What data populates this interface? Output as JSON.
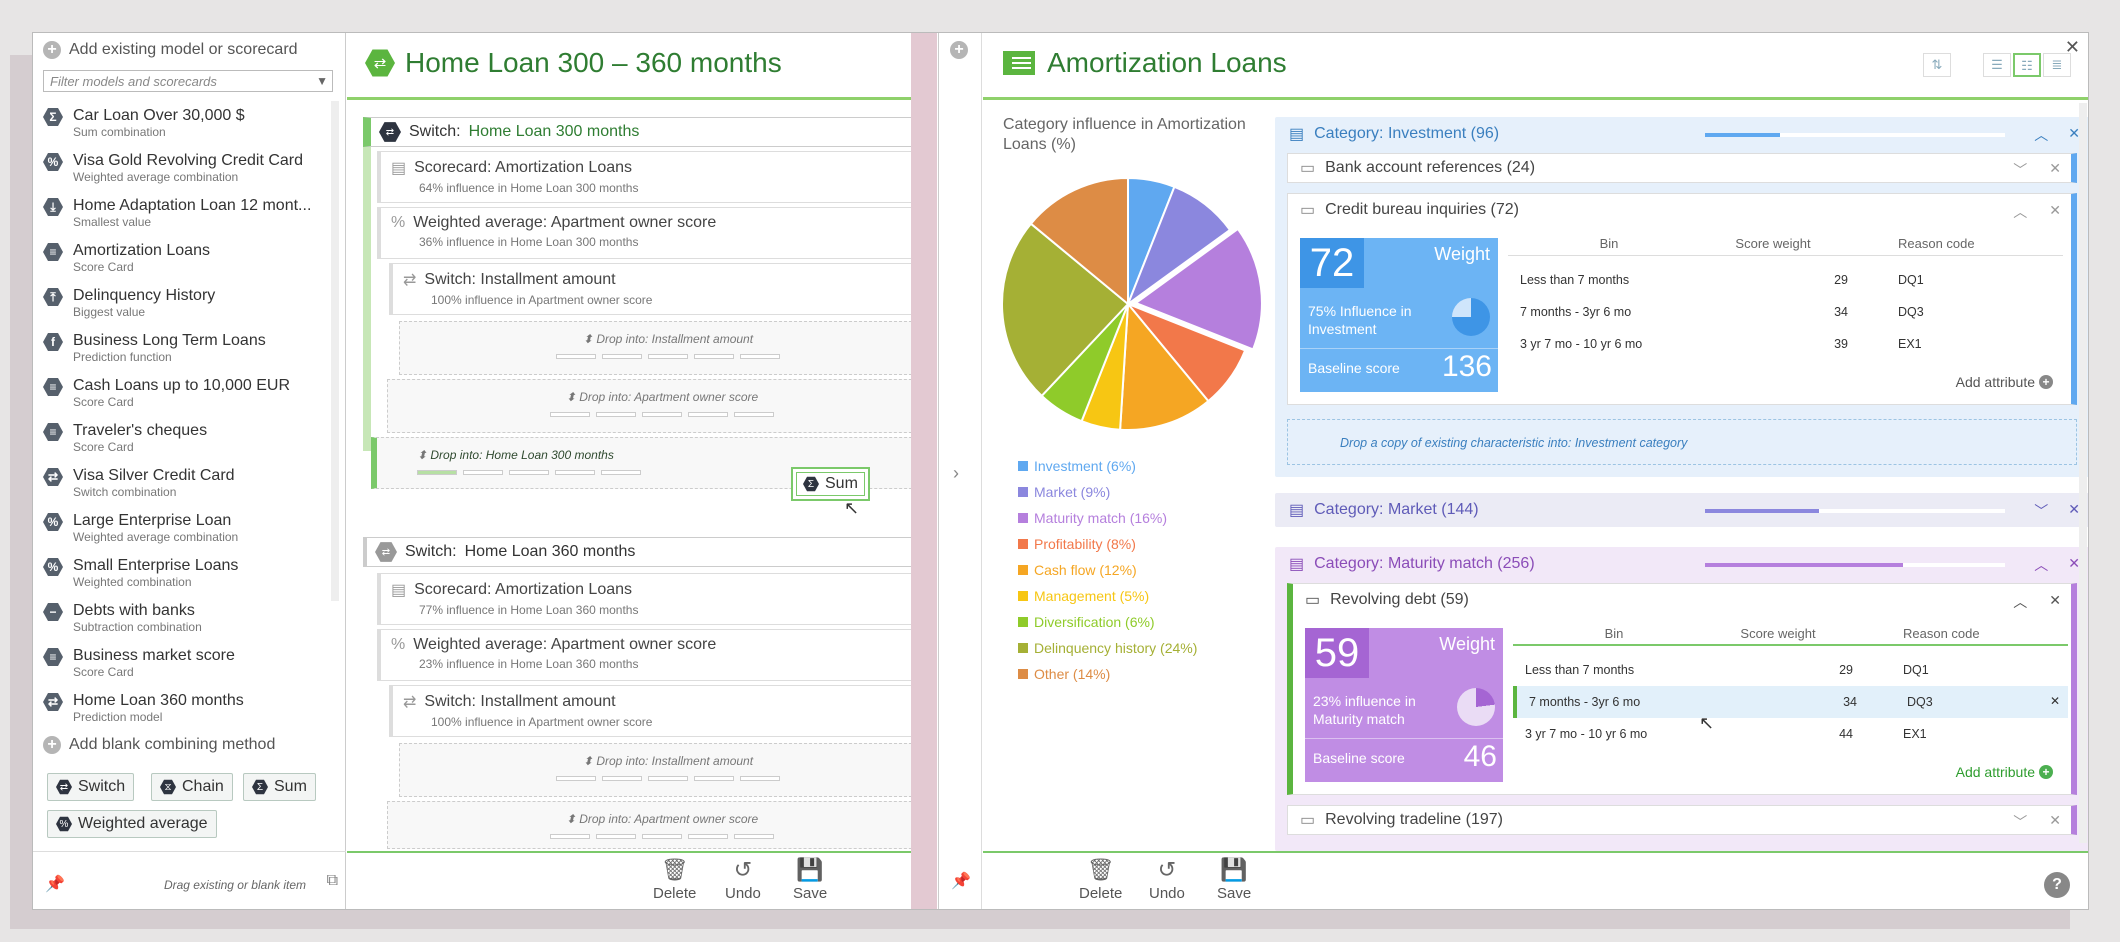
{
  "library": {
    "add_existing": "Add existing model or scorecard",
    "filter_placeholder": "Filter models and scorecards",
    "items": [
      {
        "name": "Car Loan Over 30,000 $",
        "sub": "Sum combination",
        "icon": "Σ"
      },
      {
        "name": "Visa Gold Revolving Credit Card",
        "sub": "Weighted average combination",
        "icon": "%"
      },
      {
        "name": "Home Adaptation Loan 12 mont...",
        "sub": "Smallest value",
        "icon": "⤓"
      },
      {
        "name": "Amortization Loans",
        "sub": "Score Card",
        "icon": "≡"
      },
      {
        "name": "Delinquency History",
        "sub": "Biggest value",
        "icon": "⤒"
      },
      {
        "name": "Business Long Term Loans",
        "sub": "Prediction function",
        "icon": "f"
      },
      {
        "name": "Cash Loans up to 10,000 EUR",
        "sub": "Score Card",
        "icon": "≡"
      },
      {
        "name": "Traveler's cheques",
        "sub": "Score Card",
        "icon": "≡"
      },
      {
        "name": "Visa Silver Credit Card",
        "sub": "Switch combination",
        "icon": "⇄"
      },
      {
        "name": "Large Enterprise Loan",
        "sub": "Weighted average combination",
        "icon": "%"
      },
      {
        "name": "Small Enterprise Loans",
        "sub": "Weighted combination",
        "icon": "%"
      },
      {
        "name": "Debts with banks",
        "sub": "Subtraction combination",
        "icon": "−"
      },
      {
        "name": "Business market score",
        "sub": "Score Card",
        "icon": "≡"
      },
      {
        "name": "Home Loan 360 months",
        "sub": "Prediction model",
        "icon": "⇄"
      }
    ],
    "add_blank": "Add blank combining method",
    "chips": {
      "switch": "Switch",
      "chain": "Chain",
      "sum": "Sum",
      "weighted": "Weighted average"
    },
    "footer_hint": "Drag existing or blank item"
  },
  "editor": {
    "title": "Home Loan 300 – 360 months",
    "switch1": {
      "prefix": "Switch:",
      "name": "Home Loan 300 months"
    },
    "s1_scorecard": {
      "title": "Scorecard:  Amortization Loans",
      "sub": "64% influence in Home Loan 300 months"
    },
    "s1_weighted": {
      "title": "Weighted average:  Apartment owner score",
      "sub": "36% influence in Home Loan 300 months"
    },
    "s1_switch": {
      "title": "Switch:  Installment amount",
      "sub": "100% influence in Apartment owner score"
    },
    "s1_drop1": "Drop into: Installment amount",
    "s1_drop2": "Drop into: Apartment owner score",
    "s1_drop3": "Drop into: Home Loan 300 months",
    "drag_ghost": "Sum",
    "switch2": {
      "prefix": "Switch:",
      "name": "Home Loan 360 months"
    },
    "s2_scorecard": {
      "title": "Scorecard:  Amortization Loans",
      "sub": "77% influence in Home Loan 360 months"
    },
    "s2_weighted": {
      "title": "Weighted average:  Apartment owner score",
      "sub": "23% influence in Home Loan 360 months"
    },
    "s2_switch": {
      "title": "Switch:  Installment amount",
      "sub": "100% influence in Apartment owner score"
    },
    "s2_drop1": "Drop into: Installment amount",
    "s2_drop2": "Drop into: Apartment owner score"
  },
  "footer": {
    "delete": "Delete",
    "undo": "Undo",
    "save": "Save"
  },
  "scorecard": {
    "title": "Amortization Loans",
    "pie_title": "Category influence in Amortization Loans (%)",
    "legend": [
      {
        "label": "Investment (6%)",
        "color": "#5fa8f0"
      },
      {
        "label": "Market (9%)",
        "color": "#8b87de"
      },
      {
        "label": "Maturity match (16%)",
        "color": "#b57fdd"
      },
      {
        "label": "Profitability (8%)",
        "color": "#f2784a"
      },
      {
        "label": "Cash flow (12%)",
        "color": "#f5a623"
      },
      {
        "label": "Management (5%)",
        "color": "#f7c613"
      },
      {
        "label": "Diversification (6%)",
        "color": "#8fcb2a"
      },
      {
        "label": "Delinquency history (24%)",
        "color": "#a5b035"
      },
      {
        "label": "Other (14%)",
        "color": "#dd8c45"
      }
    ],
    "cat_investment": "Category: Investment (96)",
    "bank_refs": "Bank account references (24)",
    "credit_bureau": "Credit bureau inquiries (72)",
    "cb_weight": "72",
    "cb_weight_label": "Weight",
    "cb_influence": "75% Influence in Investment",
    "cb_baseline_label": "Baseline score",
    "cb_baseline": "136",
    "table_headers": {
      "bin": "Bin",
      "weight": "Score weight",
      "reason": "Reason code"
    },
    "cb_rows": [
      {
        "bin": "Less than 7 months",
        "w": "29",
        "r": "DQ1"
      },
      {
        "bin": "7 months - 3yr 6 mo",
        "w": "34",
        "r": "DQ3"
      },
      {
        "bin": "3 yr 7 mo - 10 yr 6 mo",
        "w": "39",
        "r": "EX1"
      }
    ],
    "add_attribute": "Add attribute",
    "drop_copy": "Drop a copy of existing characteristic into: Investment category",
    "cat_market": "Category: Market (144)",
    "cat_maturity": "Category: Maturity match (256)",
    "revolving_debt": "Revolving debt (59)",
    "rd_weight": "59",
    "rd_influence": "23% influence in Maturity match",
    "rd_baseline": "46",
    "rd_rows": [
      {
        "bin": "Less than 7 months",
        "w": "29",
        "r": "DQ1"
      },
      {
        "bin": "7 months - 3yr 6 mo",
        "w": "34",
        "r": "DQ3"
      },
      {
        "bin": "3 yr 7 mo - 10 yr 6 mo",
        "w": "44",
        "r": "EX1"
      }
    ],
    "revolving_tradeline": "Revolving tradeline (197)"
  },
  "chart_data": {
    "type": "pie",
    "title": "Category influence in Amortization Loans (%)",
    "categories": [
      "Investment",
      "Market",
      "Maturity match",
      "Profitability",
      "Cash flow",
      "Management",
      "Diversification",
      "Delinquency history",
      "Other"
    ],
    "values": [
      6,
      9,
      16,
      8,
      12,
      5,
      6,
      24,
      14
    ],
    "colors": [
      "#5fa8f0",
      "#8b87de",
      "#b57fdd",
      "#f2784a",
      "#f5a623",
      "#f7c613",
      "#8fcb2a",
      "#a5b035",
      "#dd8c45"
    ]
  }
}
